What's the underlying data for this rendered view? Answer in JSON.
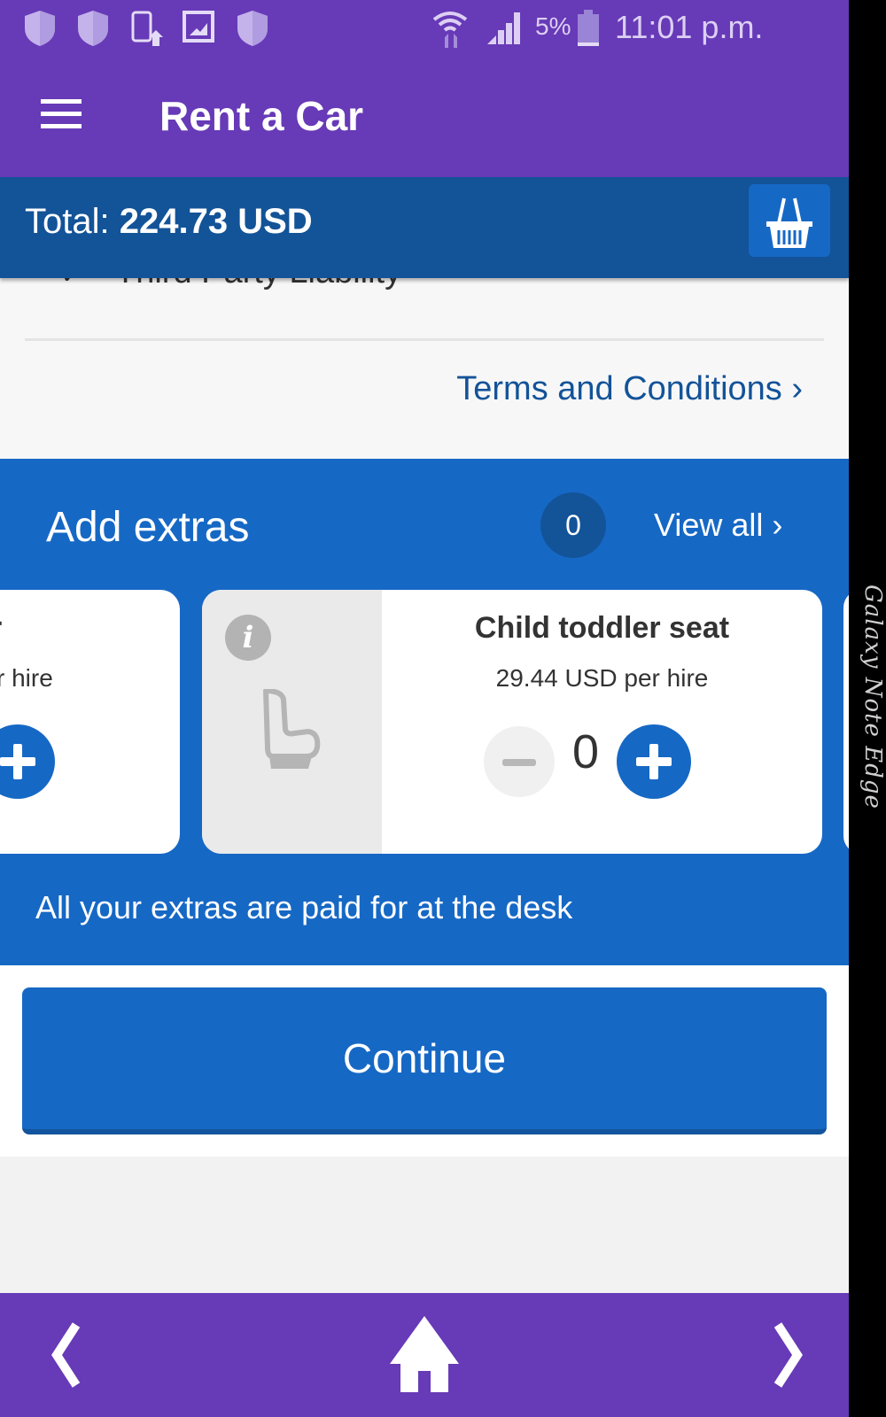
{
  "status_bar": {
    "left_icons": [
      "shield-icon",
      "shield-icon",
      "phone-update-icon",
      "gallery-icon",
      "shield-icon"
    ],
    "battery_percent": "5%",
    "time": "11:01 p.m.",
    "right_icons": [
      "wifi-icon",
      "signal-icon",
      "battery-icon"
    ]
  },
  "app_bar": {
    "title": "Rent a Car",
    "menu_icon": "hamburger-menu-icon"
  },
  "total_bar": {
    "label": "Total:",
    "amount": "224.73 USD",
    "basket_icon": "basket-icon"
  },
  "insurance": {
    "partial_item": "Third Party Liability",
    "terms_link": "Terms and Conditions",
    "terms_chevron": "›"
  },
  "extras": {
    "title": "Add extras",
    "selected_count": "0",
    "view_all_label": "View all",
    "view_all_chevron": "›",
    "cards": [
      {
        "name": "Driver",
        "price": "r hire",
        "partial": true
      },
      {
        "name": "Child toddler seat",
        "price": "29.44 USD per hire",
        "quantity": "0",
        "icon": "child-seat-icon",
        "info_glyph": "i"
      }
    ],
    "note": "All your extras are paid for at the desk"
  },
  "continue_label": "Continue",
  "bottom_nav": {
    "back_icon": "chevron-left-icon",
    "home_icon": "home-icon",
    "forward_icon": "chevron-right-icon"
  },
  "device_edge_label": "Galaxy Note Edge",
  "colors": {
    "status_purple": "#673ab7",
    "total_bar_blue": "#135398",
    "primary_blue": "#1668c5"
  }
}
